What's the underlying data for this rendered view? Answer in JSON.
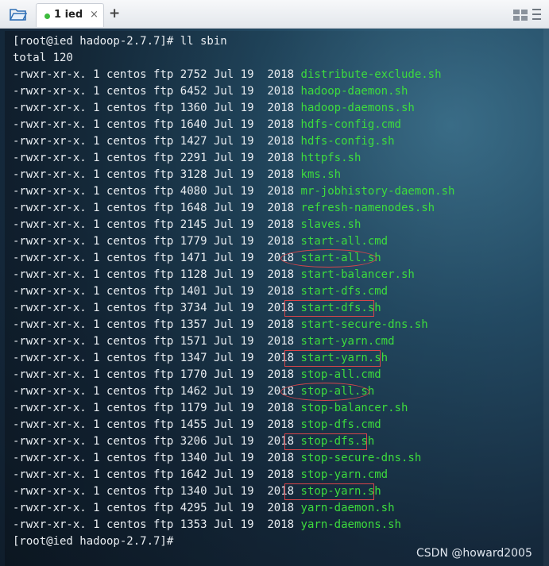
{
  "tab": {
    "label": "1 ied",
    "close": "×",
    "add": "+"
  },
  "terminal": {
    "prompt_cmd": "[root@ied hadoop-2.7.7]# ll sbin",
    "total": "total 120",
    "files": [
      {
        "perms": "-rwxr-xr-x.",
        "links": "1",
        "owner": "centos",
        "group": "ftp",
        "size": "2752",
        "date": "Jul 19",
        "year": "2018",
        "name": "distribute-exclude.sh"
      },
      {
        "perms": "-rwxr-xr-x.",
        "links": "1",
        "owner": "centos",
        "group": "ftp",
        "size": "6452",
        "date": "Jul 19",
        "year": "2018",
        "name": "hadoop-daemon.sh"
      },
      {
        "perms": "-rwxr-xr-x.",
        "links": "1",
        "owner": "centos",
        "group": "ftp",
        "size": "1360",
        "date": "Jul 19",
        "year": "2018",
        "name": "hadoop-daemons.sh"
      },
      {
        "perms": "-rwxr-xr-x.",
        "links": "1",
        "owner": "centos",
        "group": "ftp",
        "size": "1640",
        "date": "Jul 19",
        "year": "2018",
        "name": "hdfs-config.cmd"
      },
      {
        "perms": "-rwxr-xr-x.",
        "links": "1",
        "owner": "centos",
        "group": "ftp",
        "size": "1427",
        "date": "Jul 19",
        "year": "2018",
        "name": "hdfs-config.sh"
      },
      {
        "perms": "-rwxr-xr-x.",
        "links": "1",
        "owner": "centos",
        "group": "ftp",
        "size": "2291",
        "date": "Jul 19",
        "year": "2018",
        "name": "httpfs.sh"
      },
      {
        "perms": "-rwxr-xr-x.",
        "links": "1",
        "owner": "centos",
        "group": "ftp",
        "size": "3128",
        "date": "Jul 19",
        "year": "2018",
        "name": "kms.sh"
      },
      {
        "perms": "-rwxr-xr-x.",
        "links": "1",
        "owner": "centos",
        "group": "ftp",
        "size": "4080",
        "date": "Jul 19",
        "year": "2018",
        "name": "mr-jobhistory-daemon.sh"
      },
      {
        "perms": "-rwxr-xr-x.",
        "links": "1",
        "owner": "centos",
        "group": "ftp",
        "size": "1648",
        "date": "Jul 19",
        "year": "2018",
        "name": "refresh-namenodes.sh"
      },
      {
        "perms": "-rwxr-xr-x.",
        "links": "1",
        "owner": "centos",
        "group": "ftp",
        "size": "2145",
        "date": "Jul 19",
        "year": "2018",
        "name": "slaves.sh"
      },
      {
        "perms": "-rwxr-xr-x.",
        "links": "1",
        "owner": "centos",
        "group": "ftp",
        "size": "1779",
        "date": "Jul 19",
        "year": "2018",
        "name": "start-all.cmd"
      },
      {
        "perms": "-rwxr-xr-x.",
        "links": "1",
        "owner": "centos",
        "group": "ftp",
        "size": "1471",
        "date": "Jul 19",
        "year": "2018",
        "name": "start-all.sh"
      },
      {
        "perms": "-rwxr-xr-x.",
        "links": "1",
        "owner": "centos",
        "group": "ftp",
        "size": "1128",
        "date": "Jul 19",
        "year": "2018",
        "name": "start-balancer.sh"
      },
      {
        "perms": "-rwxr-xr-x.",
        "links": "1",
        "owner": "centos",
        "group": "ftp",
        "size": "1401",
        "date": "Jul 19",
        "year": "2018",
        "name": "start-dfs.cmd"
      },
      {
        "perms": "-rwxr-xr-x.",
        "links": "1",
        "owner": "centos",
        "group": "ftp",
        "size": "3734",
        "date": "Jul 19",
        "year": "2018",
        "name": "start-dfs.sh"
      },
      {
        "perms": "-rwxr-xr-x.",
        "links": "1",
        "owner": "centos",
        "group": "ftp",
        "size": "1357",
        "date": "Jul 19",
        "year": "2018",
        "name": "start-secure-dns.sh"
      },
      {
        "perms": "-rwxr-xr-x.",
        "links": "1",
        "owner": "centos",
        "group": "ftp",
        "size": "1571",
        "date": "Jul 19",
        "year": "2018",
        "name": "start-yarn.cmd"
      },
      {
        "perms": "-rwxr-xr-x.",
        "links": "1",
        "owner": "centos",
        "group": "ftp",
        "size": "1347",
        "date": "Jul 19",
        "year": "2018",
        "name": "start-yarn.sh"
      },
      {
        "perms": "-rwxr-xr-x.",
        "links": "1",
        "owner": "centos",
        "group": "ftp",
        "size": "1770",
        "date": "Jul 19",
        "year": "2018",
        "name": "stop-all.cmd"
      },
      {
        "perms": "-rwxr-xr-x.",
        "links": "1",
        "owner": "centos",
        "group": "ftp",
        "size": "1462",
        "date": "Jul 19",
        "year": "2018",
        "name": "stop-all.sh"
      },
      {
        "perms": "-rwxr-xr-x.",
        "links": "1",
        "owner": "centos",
        "group": "ftp",
        "size": "1179",
        "date": "Jul 19",
        "year": "2018",
        "name": "stop-balancer.sh"
      },
      {
        "perms": "-rwxr-xr-x.",
        "links": "1",
        "owner": "centos",
        "group": "ftp",
        "size": "1455",
        "date": "Jul 19",
        "year": "2018",
        "name": "stop-dfs.cmd"
      },
      {
        "perms": "-rwxr-xr-x.",
        "links": "1",
        "owner": "centos",
        "group": "ftp",
        "size": "3206",
        "date": "Jul 19",
        "year": "2018",
        "name": "stop-dfs.sh"
      },
      {
        "perms": "-rwxr-xr-x.",
        "links": "1",
        "owner": "centos",
        "group": "ftp",
        "size": "1340",
        "date": "Jul 19",
        "year": "2018",
        "name": "stop-secure-dns.sh"
      },
      {
        "perms": "-rwxr-xr-x.",
        "links": "1",
        "owner": "centos",
        "group": "ftp",
        "size": "1642",
        "date": "Jul 19",
        "year": "2018",
        "name": "stop-yarn.cmd"
      },
      {
        "perms": "-rwxr-xr-x.",
        "links": "1",
        "owner": "centos",
        "group": "ftp",
        "size": "1340",
        "date": "Jul 19",
        "year": "2018",
        "name": "stop-yarn.sh"
      },
      {
        "perms": "-rwxr-xr-x.",
        "links": "1",
        "owner": "centos",
        "group": "ftp",
        "size": "4295",
        "date": "Jul 19",
        "year": "2018",
        "name": "yarn-daemon.sh"
      },
      {
        "perms": "-rwxr-xr-x.",
        "links": "1",
        "owner": "centos",
        "group": "ftp",
        "size": "1353",
        "date": "Jul 19",
        "year": "2018",
        "name": "yarn-daemons.sh"
      }
    ],
    "final_prompt": "[root@ied hadoop-2.7.7]#",
    "annotations": [
      {
        "file": "start-all.sh",
        "shape": "oval"
      },
      {
        "file": "start-dfs.sh",
        "shape": "rect"
      },
      {
        "file": "start-yarn.sh",
        "shape": "rect"
      },
      {
        "file": "stop-all.sh",
        "shape": "oval"
      },
      {
        "file": "stop-dfs.sh",
        "shape": "rect"
      },
      {
        "file": "stop-yarn.sh",
        "shape": "rect"
      }
    ]
  },
  "watermark": "CSDN @howard2005",
  "colors": {
    "filename": "#3ddc3d",
    "text": "#e9edf1",
    "annotation": "#d8454a",
    "tab_status": "#3dbb3d"
  }
}
